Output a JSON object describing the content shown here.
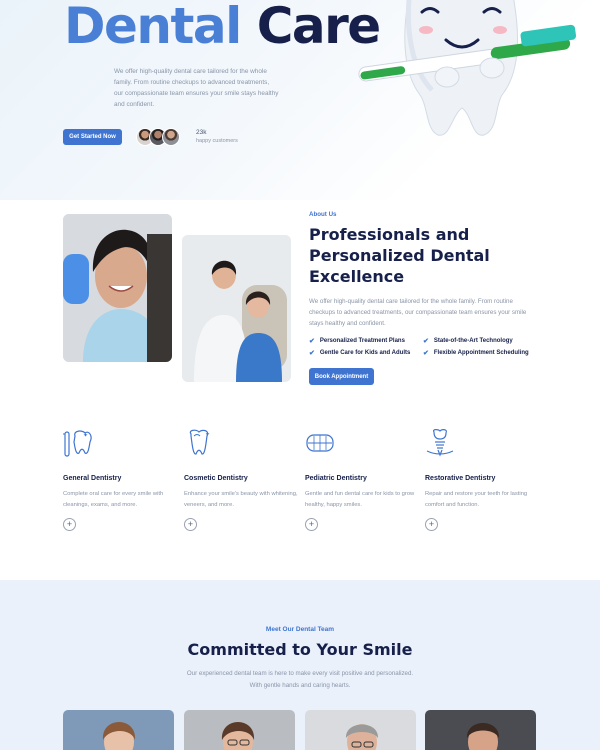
{
  "hero": {
    "title_word1": "Dental",
    "title_word2": "Care",
    "description": "We offer high-quality dental care tailored for the whole family. From routine checkups to advanced treatments, our compassionate team ensures your smile stays healthy and confident.",
    "cta_label": "Get Started Now",
    "customers_count": "23k",
    "customers_label": "happy customers"
  },
  "about": {
    "label": "About Us",
    "title": "Professionals and Personalized Dental Excellence",
    "description": "We offer high-quality dental care tailored for the whole family. From routine checkups to advanced treatments, our compassionate team ensures your smile stays healthy and confident.",
    "features": [
      "Personalized Treatment Plans",
      "State-of-the-Art Technology",
      "Gentle Care for Kids and Adults",
      "Flexible Appointment Scheduling"
    ],
    "cta_label": "Book Appointment"
  },
  "services": [
    {
      "title": "General Dentistry",
      "desc": "Complete oral care for every smile with cleanings, exams, and more.",
      "icon": "tooth-brush-icon"
    },
    {
      "title": "Cosmetic Dentistry",
      "desc": "Enhance your smile's beauty with whitening, veneers, and more.",
      "icon": "tooth-icon"
    },
    {
      "title": "Pediatric Dentistry",
      "desc": "Gentle and fun dental care for kids to grow healthy, happy smiles.",
      "icon": "teeth-icon"
    },
    {
      "title": "Restorative Dentistry",
      "desc": "Repair and restore your teeth for lasting comfort and function.",
      "icon": "implant-icon"
    }
  ],
  "team": {
    "label": "Meet Our Dental Team",
    "title": "Committed to Your Smile",
    "description": "Our experienced dental team is here to make every visit positive and personalized. With gentle hands and caring hearts."
  },
  "colors": {
    "accent": "#3f74d1",
    "heading": "#16204a",
    "hero_blue": "#4a7fd6",
    "team_bg": "#eaf1fb"
  }
}
